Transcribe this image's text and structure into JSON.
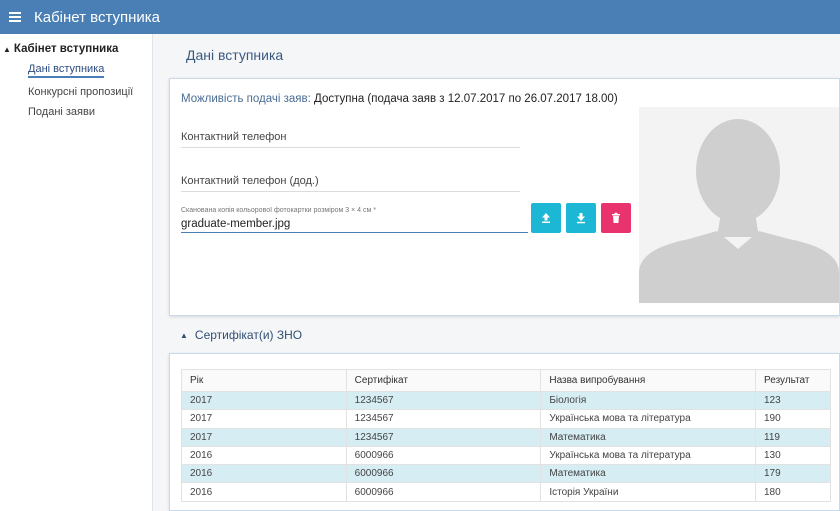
{
  "app": {
    "title": "Кабінет вступника"
  },
  "sidebar": {
    "header": "Кабінет вступника",
    "items": [
      {
        "label": "Дані вступника"
      },
      {
        "label": "Конкурсні пропозиції"
      },
      {
        "label": "Подані заяви"
      }
    ]
  },
  "main": {
    "title": "Дані вступника",
    "availability_label": "Можливість подачі заяв:",
    "availability_value": "Доступна (подача заяв з 12.07.2017 по 26.07.2017 18.00)",
    "phone_label": "Контактний телефон",
    "phone_extra_label": "Контактний телефон (дод.)",
    "photo_field_label": "Сканована копія кольорової фотокартки розміром 3 × 4 см *",
    "photo_field_value": "graduate-member.jpg"
  },
  "colors": {
    "accent": "#4a7fb5",
    "button_teal": "#1bb7d4",
    "button_pink": "#e8336f",
    "row_highlight": "#d6eef3"
  },
  "zno": {
    "section_title": "Сертифікат(и) ЗНО",
    "columns": [
      "Рік",
      "Сертифікат",
      "Назва випробування",
      "Результат"
    ],
    "rows": [
      [
        "2017",
        "1234567",
        "Біологія",
        "123"
      ],
      [
        "2017",
        "1234567",
        "Українська мова та література",
        "190"
      ],
      [
        "2017",
        "1234567",
        "Математика",
        "119"
      ],
      [
        "2016",
        "6000966",
        "Українська мова та література",
        "130"
      ],
      [
        "2016",
        "6000966",
        "Математика",
        "179"
      ],
      [
        "2016",
        "6000966",
        "Історія України",
        "180"
      ]
    ]
  }
}
